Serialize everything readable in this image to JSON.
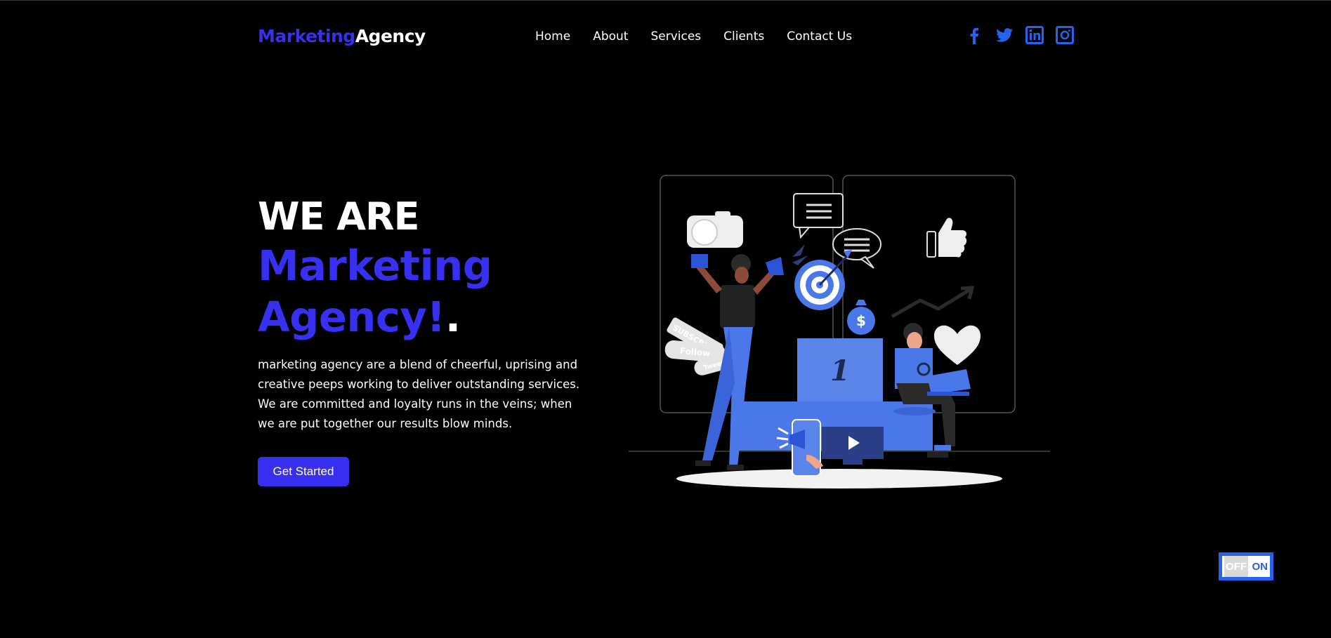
{
  "header": {
    "logo_part1": "Marketing",
    "logo_part2": "Agency",
    "nav": [
      "Home",
      "About",
      "Services",
      "Clients",
      "Contact Us"
    ],
    "social_icons": [
      "facebook-icon",
      "twitter-icon",
      "linkedin-icon",
      "instagram-icon"
    ]
  },
  "hero": {
    "line1": "WE ARE",
    "line2": "Marketing",
    "line3": "Agency!",
    "line3_dot": ".",
    "description": "marketing agency are a blend of cheerful, uprising and creative peeps working to deliver outstanding services. We are committed and loyalty runs in the veins; when we are put together our results blow minds.",
    "cta_label": "Get Started"
  },
  "illustration": {
    "podium_number": "1",
    "labels": [
      "SUBSCRIBE",
      "Follow",
      "Tweet"
    ],
    "money_symbol": "$"
  },
  "toggle": {
    "off_label": "OFF",
    "on_label": "ON"
  },
  "colors": {
    "background": "#000000",
    "accent": "#3730f0",
    "illustration_blue": "#4a78e8",
    "text": "#ffffff"
  }
}
